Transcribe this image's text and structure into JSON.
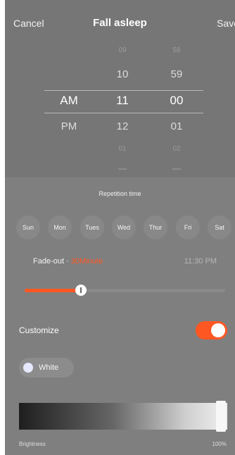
{
  "header": {
    "cancel_label": "Cancel",
    "title": "Fall asleep",
    "save_label": "Save"
  },
  "picker": {
    "ampm": {
      "selected": "AM",
      "below": "PM"
    },
    "hours": {
      "faint_above": "09",
      "above": "10",
      "selected": "11",
      "below": "12",
      "faint_below": "01"
    },
    "minutes": {
      "faint_above": "58",
      "above": "59",
      "selected": "00",
      "below": "01",
      "faint_below": "02"
    }
  },
  "repetition": {
    "title": "Repetition time",
    "days": [
      "Sun",
      "Mon",
      "Tues",
      "Wed",
      "Thur",
      "Fri",
      "Sat"
    ]
  },
  "fade": {
    "label": "Fade-out · ",
    "value": "30Minute",
    "end_time": "11:30 PM",
    "slider_fraction": 0.28
  },
  "customize": {
    "label": "Customize",
    "enabled": true
  },
  "color_chip": {
    "label": "White"
  },
  "brightness": {
    "label": "Brightness",
    "value": "100%"
  },
  "colors": {
    "accent": "#ff5722",
    "background": "#7f7f7f",
    "chip_dot": "#e6e9ff"
  }
}
